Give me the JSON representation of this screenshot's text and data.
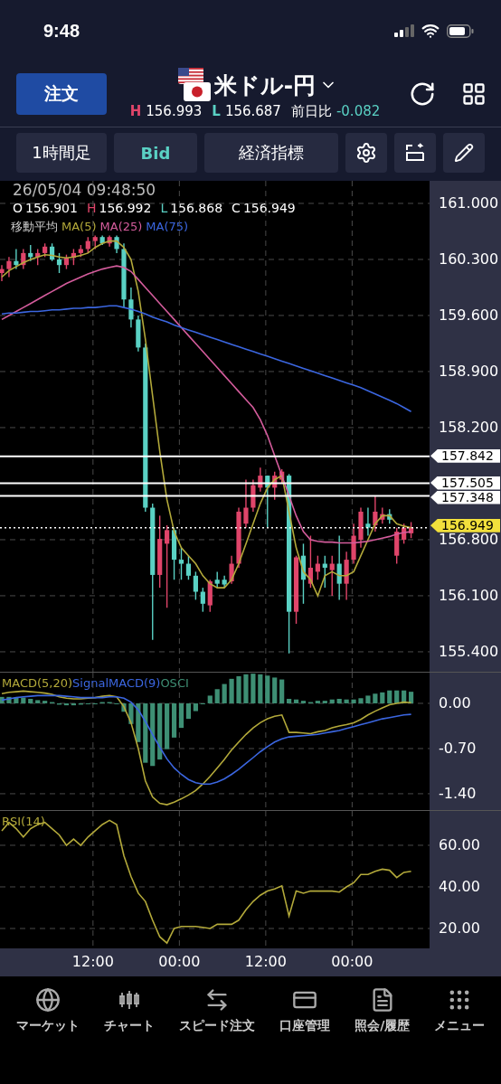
{
  "status_bar": {
    "time": "9:48"
  },
  "header": {
    "order_button": "注文",
    "pair": "米ドル-円",
    "high_label": "H",
    "high": "156.993",
    "low_label": "L",
    "low": "156.687",
    "change_label": "前日比",
    "change": "-0.082"
  },
  "toolbar": [
    {
      "kind": "text",
      "label": "1時間足"
    },
    {
      "kind": "accent",
      "label": "Bid"
    },
    {
      "kind": "text",
      "label": "経済指標"
    },
    {
      "kind": "settings"
    },
    {
      "kind": "rotate"
    },
    {
      "kind": "draw"
    }
  ],
  "main_chart": {
    "timestamp": "26/05/04 09:48:50",
    "ohlc": [
      {
        "label": "O",
        "value": "156.901",
        "color": "#ffffff"
      },
      {
        "label": "H",
        "value": "156.992",
        "color": "#e0456a"
      },
      {
        "label": "L",
        "value": "156.868",
        "color": "#5ad1c4"
      },
      {
        "label": "C",
        "value": "156.949",
        "color": "#ffffff"
      }
    ],
    "indicator_label": "移動平均",
    "chart_data": {
      "type": "candlestick",
      "ylim": [
        155.151,
        161.282
      ],
      "yticks": [
        {
          "value": 161,
          "label": "161.000"
        },
        {
          "value": 160.3,
          "label": "160.300"
        },
        {
          "value": 159.6,
          "label": "159.600"
        },
        {
          "value": 158.9,
          "label": "158.900"
        },
        {
          "value": 158.2,
          "label": "158.200"
        },
        {
          "value": 156.8,
          "label": "156.800"
        },
        {
          "value": 156.1,
          "label": "156.100"
        },
        {
          "value": 155.4,
          "label": "155.400"
        }
      ],
      "grid": true,
      "ohlc": [
        [
          160.13,
          160.23,
          160.03,
          160.18
        ],
        [
          160.18,
          160.33,
          160.08,
          160.28
        ],
        [
          160.28,
          160.43,
          160.18,
          160.23
        ],
        [
          160.23,
          160.43,
          160.18,
          160.38
        ],
        [
          160.38,
          160.48,
          160.28,
          160.33
        ],
        [
          160.33,
          160.43,
          160.23,
          160.38
        ],
        [
          160.38,
          160.5,
          160.33,
          160.46
        ],
        [
          160.46,
          160.5,
          160.28,
          160.3
        ],
        [
          160.3,
          160.38,
          160.13,
          160.23
        ],
        [
          160.23,
          160.36,
          160.18,
          160.32
        ],
        [
          160.32,
          160.43,
          160.23,
          160.38
        ],
        [
          160.38,
          160.48,
          160.33,
          160.43
        ],
        [
          160.43,
          160.58,
          160.38,
          160.53
        ],
        [
          160.53,
          160.6,
          160.43,
          160.58
        ],
        [
          160.58,
          160.6,
          160.48,
          160.5
        ],
        [
          160.5,
          160.6,
          160.46,
          160.58
        ],
        [
          160.58,
          160.6,
          160.38,
          160.43
        ],
        [
          160.43,
          160.5,
          159.7,
          159.8
        ],
        [
          159.8,
          159.95,
          159.45,
          159.55
        ],
        [
          159.55,
          159.6,
          159.15,
          159.2
        ],
        [
          159.2,
          159.25,
          157.15,
          157.2
        ],
        [
          157.2,
          157.25,
          155.55,
          156.36
        ],
        [
          156.36,
          157.1,
          156.2,
          156.81
        ],
        [
          156.75,
          156.98,
          155.95,
          156.92
        ],
        [
          156.92,
          156.95,
          156.3,
          156.55
        ],
        [
          156.55,
          156.7,
          156.3,
          156.5
        ],
        [
          156.5,
          156.6,
          156.3,
          156.35
        ],
        [
          156.35,
          156.4,
          156.05,
          156.15
        ],
        [
          156.15,
          156.2,
          155.9,
          156.0
        ],
        [
          155.98,
          156.3,
          155.9,
          156.28
        ],
        [
          156.3,
          156.4,
          156.2,
          156.25
        ],
        [
          156.3,
          156.35,
          156.2,
          156.24
        ],
        [
          156.28,
          156.6,
          156.25,
          156.5
        ],
        [
          156.5,
          157.2,
          156.45,
          157.15
        ],
        [
          157.0,
          157.55,
          156.95,
          157.2
        ],
        [
          157.2,
          157.55,
          157.15,
          157.48
        ],
        [
          157.45,
          157.7,
          157.4,
          157.6
        ],
        [
          157.6,
          157.6,
          156.95,
          157.45
        ],
        [
          157.45,
          157.65,
          157.3,
          157.6
        ],
        [
          157.55,
          157.68,
          157.5,
          157.65
        ],
        [
          157.6,
          157.62,
          155.38,
          155.9
        ],
        [
          155.9,
          156.6,
          155.75,
          156.58
        ],
        [
          156.6,
          156.75,
          156.0,
          156.3
        ],
        [
          156.25,
          156.85,
          156.2,
          156.45
        ],
        [
          156.4,
          156.6,
          156.3,
          156.5
        ],
        [
          156.5,
          156.6,
          156.2,
          156.45
        ],
        [
          156.42,
          156.6,
          156.1,
          156.5
        ],
        [
          156.5,
          156.85,
          156.05,
          156.25
        ],
        [
          156.25,
          156.65,
          156.05,
          156.55
        ],
        [
          156.55,
          157.0,
          156.5,
          156.85
        ],
        [
          156.8,
          157.2,
          156.7,
          157.15
        ],
        [
          157.0,
          157.2,
          156.85,
          156.95
        ],
        [
          156.98,
          157.35,
          156.9,
          157.15
        ],
        [
          157.05,
          157.2,
          157.0,
          157.12
        ],
        [
          157.12,
          157.18,
          157.0,
          157.05
        ],
        [
          156.6,
          156.95,
          156.5,
          156.9
        ],
        [
          156.8,
          157.0,
          156.75,
          156.95
        ],
        [
          156.88,
          157.02,
          156.82,
          156.949
        ]
      ],
      "series": [
        {
          "name": "MA(5)",
          "type": "line",
          "color": "#b3a93a",
          "values": [
            160.08,
            160.16,
            160.21,
            160.26,
            160.3,
            160.33,
            160.36,
            160.35,
            160.33,
            160.32,
            160.33,
            160.35,
            160.38,
            160.45,
            160.5,
            160.53,
            160.53,
            160.45,
            160.3,
            159.9,
            159.3,
            158.6,
            157.9,
            157.3,
            156.9,
            156.7,
            156.6,
            156.5,
            156.35,
            156.25,
            156.2,
            156.2,
            156.3,
            156.5,
            156.75,
            157.0,
            157.25,
            157.45,
            157.55,
            157.6,
            157.15,
            156.7,
            156.4,
            156.3,
            156.1,
            156.35,
            156.4,
            156.35,
            156.35,
            156.4,
            156.6,
            156.8,
            157.0,
            157.1,
            157.1,
            157.0,
            156.97,
            156.95
          ]
        },
        {
          "name": "MA(25)",
          "type": "line",
          "color": "#d45c9c",
          "values": [
            159.55,
            159.6,
            159.65,
            159.7,
            159.75,
            159.8,
            159.85,
            159.9,
            159.95,
            160.0,
            160.04,
            160.08,
            160.12,
            160.15,
            160.18,
            160.2,
            160.22,
            160.2,
            160.15,
            160.05,
            159.95,
            159.85,
            159.75,
            159.65,
            159.55,
            159.45,
            159.35,
            159.25,
            159.15,
            159.05,
            158.95,
            158.85,
            158.75,
            158.65,
            158.55,
            158.45,
            158.3,
            158.1,
            157.85,
            157.6,
            157.35,
            157.1,
            156.9,
            156.8,
            156.78,
            156.77,
            156.77,
            156.76,
            156.76,
            156.76,
            156.77,
            156.78,
            156.8,
            156.82,
            156.84,
            156.87,
            156.89,
            156.9
          ]
        },
        {
          "name": "MA(75)",
          "type": "line",
          "color": "#3b66e0",
          "values": [
            159.62,
            159.63,
            159.63,
            159.64,
            159.65,
            159.65,
            159.66,
            159.67,
            159.67,
            159.68,
            159.69,
            159.69,
            159.7,
            159.7,
            159.71,
            159.72,
            159.72,
            159.7,
            159.68,
            159.65,
            159.62,
            159.58,
            159.55,
            159.52,
            159.48,
            159.45,
            159.42,
            159.39,
            159.36,
            159.33,
            159.3,
            159.27,
            159.24,
            159.21,
            159.18,
            159.15,
            159.12,
            159.09,
            159.06,
            159.03,
            159.0,
            158.97,
            158.94,
            158.91,
            158.88,
            158.85,
            158.82,
            158.79,
            158.76,
            158.73,
            158.7,
            158.66,
            158.62,
            158.58,
            158.54,
            158.5,
            158.45,
            158.4
          ]
        }
      ],
      "ref_lines": [
        {
          "axis": "y",
          "value": 157.842,
          "label": "157.842"
        },
        {
          "axis": "y",
          "value": 157.505,
          "label": "157.505"
        },
        {
          "axis": "y",
          "value": 157.348,
          "label": "157.348"
        },
        {
          "axis": "y",
          "value": 156.949,
          "label": "156.949"
        }
      ]
    },
    "time_axis": [
      {
        "label": "12:00"
      },
      {
        "label": "00:00"
      },
      {
        "label": "12:00"
      },
      {
        "label": "00:00"
      }
    ]
  },
  "macd_chart": {
    "chart_data": {
      "type": "line",
      "grid": true,
      "ylim": [
        -1.667,
        0.476
      ],
      "yticks": [
        {
          "value": 0,
          "label": "0.00"
        },
        {
          "value": -0.7,
          "label": "-0.70"
        },
        {
          "value": -1.4,
          "label": "-1.40"
        }
      ],
      "series": [
        {
          "name": "MACD(5,20)",
          "color": "#b3a93a",
          "values": [
            0.15,
            0.17,
            0.18,
            0.19,
            0.18,
            0.17,
            0.16,
            0.14,
            0.1,
            0.08,
            0.07,
            0.07,
            0.08,
            0.09,
            0.11,
            0.12,
            0.1,
            -0.05,
            -0.3,
            -0.7,
            -1.2,
            -1.45,
            -1.55,
            -1.57,
            -1.53,
            -1.48,
            -1.42,
            -1.35,
            -1.25,
            -1.13,
            -1.0,
            -0.87,
            -0.72,
            -0.6,
            -0.48,
            -0.38,
            -0.3,
            -0.24,
            -0.2,
            -0.18,
            -0.45,
            -0.45,
            -0.46,
            -0.47,
            -0.44,
            -0.42,
            -0.38,
            -0.35,
            -0.33,
            -0.3,
            -0.25,
            -0.18,
            -0.12,
            -0.07,
            -0.02,
            0.0,
            0.02,
            0.01
          ]
        },
        {
          "name": "SignalMACD(9)",
          "color": "#3b66e0",
          "values": [
            0.05,
            0.07,
            0.09,
            0.1,
            0.11,
            0.12,
            0.12,
            0.12,
            0.12,
            0.11,
            0.1,
            0.09,
            0.09,
            0.09,
            0.09,
            0.1,
            0.1,
            0.08,
            0.02,
            -0.1,
            -0.28,
            -0.48,
            -0.68,
            -0.86,
            -1.0,
            -1.1,
            -1.18,
            -1.23,
            -1.25,
            -1.25,
            -1.22,
            -1.17,
            -1.1,
            -1.02,
            -0.93,
            -0.84,
            -0.75,
            -0.67,
            -0.6,
            -0.55,
            -0.52,
            -0.51,
            -0.5,
            -0.49,
            -0.48,
            -0.46,
            -0.44,
            -0.42,
            -0.39,
            -0.36,
            -0.33,
            -0.3,
            -0.27,
            -0.24,
            -0.22,
            -0.2,
            -0.18,
            -0.17
          ]
        },
        {
          "name": "OSCI",
          "type": "bar",
          "color": "#3e8f74",
          "values": [
            0.1,
            0.1,
            0.09,
            0.09,
            0.07,
            0.05,
            0.04,
            0.02,
            -0.02,
            -0.03,
            -0.03,
            -0.02,
            -0.01,
            0,
            0.02,
            0.02,
            0,
            -0.13,
            -0.32,
            -0.6,
            -0.92,
            -0.97,
            -0.87,
            -0.71,
            -0.53,
            -0.38,
            -0.24,
            -0.12,
            0,
            0.12,
            0.22,
            0.3,
            0.38,
            0.42,
            0.45,
            0.46,
            0.45,
            0.43,
            0.4,
            0.37,
            0.07,
            0.06,
            0.04,
            0.02,
            0.04,
            0.04,
            0.06,
            0.07,
            0.06,
            0.06,
            0.08,
            0.12,
            0.15,
            0.17,
            0.2,
            0.2,
            0.2,
            0.18
          ]
        }
      ]
    }
  },
  "rsi_chart": {
    "chart_data": {
      "type": "line",
      "grid": true,
      "ylim": [
        10,
        76.5
      ],
      "yticks": [
        {
          "value": 60,
          "label": "60.00"
        },
        {
          "value": 40,
          "label": "40.00"
        },
        {
          "value": 20,
          "label": "20.00"
        }
      ],
      "series": [
        {
          "name": "RSI(14)",
          "color": "#b3a93a",
          "values": [
            67,
            71,
            68,
            64,
            68,
            70,
            71,
            68,
            65,
            60,
            63,
            60,
            64,
            67,
            70,
            72,
            70,
            55,
            45,
            37,
            33,
            24,
            16,
            13,
            20,
            21,
            21,
            21,
            20.5,
            20,
            22,
            22,
            22,
            24,
            29,
            33,
            36,
            38,
            39,
            40.5,
            26,
            38,
            37,
            38,
            38,
            38,
            38,
            37.5,
            40,
            42,
            46,
            46,
            47.5,
            48.5,
            48,
            44.5,
            47,
            47.5
          ]
        }
      ]
    }
  },
  "nav": [
    {
      "kind": "globe",
      "label": "マーケット"
    },
    {
      "kind": "candles",
      "label": "チャート"
    },
    {
      "kind": "swap",
      "label": "スピード注文"
    },
    {
      "kind": "card",
      "label": "口座管理"
    },
    {
      "kind": "document",
      "label": "照会/履歴"
    },
    {
      "kind": "grid",
      "label": "メニュー"
    }
  ]
}
